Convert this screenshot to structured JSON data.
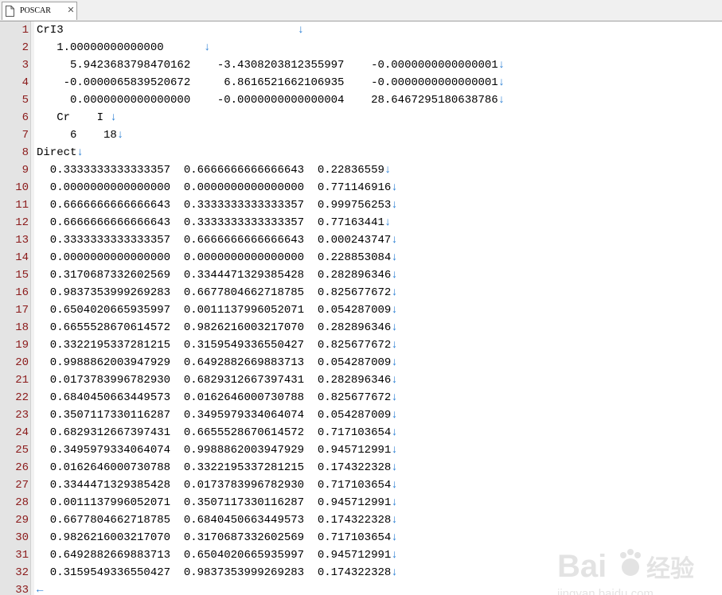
{
  "tab": {
    "title": "POSCAR",
    "close_glyph": "✕",
    "icon": "document-icon"
  },
  "eol_colors": {
    "line_numbers": "#8b1a1a",
    "eol_marker": "#2a7fd4"
  },
  "lines": [
    {
      "n": "1",
      "text": "CrI3                                   ",
      "eol": "↓"
    },
    {
      "n": "2",
      "text": "   1.00000000000000      ",
      "eol": "↓"
    },
    {
      "n": "3",
      "text": "     5.9423683798470162    -3.4308203812355997    -0.0000000000000001",
      "eol": "↓"
    },
    {
      "n": "4",
      "text": "    -0.0000065839520672     6.8616521662106935    -0.0000000000000001",
      "eol": "↓"
    },
    {
      "n": "5",
      "text": "     0.0000000000000000    -0.0000000000000004    28.6467295180638786",
      "eol": "↓"
    },
    {
      "n": "6",
      "text": "   Cr    I ",
      "eol": "↓"
    },
    {
      "n": "7",
      "text": "     6    18",
      "eol": "↓"
    },
    {
      "n": "8",
      "text": "Direct",
      "eol": "↓"
    },
    {
      "n": "9",
      "text": "  0.3333333333333357  0.6666666666666643  0.22836559",
      "eol": "↓"
    },
    {
      "n": "10",
      "text": "  0.0000000000000000  0.0000000000000000  0.771146916",
      "eol": "↓"
    },
    {
      "n": "11",
      "text": "  0.6666666666666643  0.3333333333333357  0.999756253",
      "eol": "↓"
    },
    {
      "n": "12",
      "text": "  0.6666666666666643  0.3333333333333357  0.77163441",
      "eol": "↓"
    },
    {
      "n": "13",
      "text": "  0.3333333333333357  0.6666666666666643  0.000243747",
      "eol": "↓"
    },
    {
      "n": "14",
      "text": "  0.0000000000000000  0.0000000000000000  0.228853084",
      "eol": "↓"
    },
    {
      "n": "15",
      "text": "  0.3170687332602569  0.3344471329385428  0.282896346",
      "eol": "↓"
    },
    {
      "n": "16",
      "text": "  0.9837353999269283  0.6677804662718785  0.825677672",
      "eol": "↓"
    },
    {
      "n": "17",
      "text": "  0.6504020665935997  0.0011137996052071  0.054287009",
      "eol": "↓"
    },
    {
      "n": "18",
      "text": "  0.6655528670614572  0.9826216003217070  0.282896346",
      "eol": "↓"
    },
    {
      "n": "19",
      "text": "  0.3322195337281215  0.3159549336550427  0.825677672",
      "eol": "↓"
    },
    {
      "n": "20",
      "text": "  0.9988862003947929  0.6492882669883713  0.054287009",
      "eol": "↓"
    },
    {
      "n": "21",
      "text": "  0.0173783996782930  0.6829312667397431  0.282896346",
      "eol": "↓"
    },
    {
      "n": "22",
      "text": "  0.6840450663449573  0.0162646000730788  0.825677672",
      "eol": "↓"
    },
    {
      "n": "23",
      "text": "  0.3507117330116287  0.3495979334064074  0.054287009",
      "eol": "↓"
    },
    {
      "n": "24",
      "text": "  0.6829312667397431  0.6655528670614572  0.717103654",
      "eol": "↓"
    },
    {
      "n": "25",
      "text": "  0.3495979334064074  0.9988862003947929  0.945712991",
      "eol": "↓"
    },
    {
      "n": "26",
      "text": "  0.0162646000730788  0.3322195337281215  0.174322328",
      "eol": "↓"
    },
    {
      "n": "27",
      "text": "  0.3344471329385428  0.0173783996782930  0.717103654",
      "eol": "↓"
    },
    {
      "n": "28",
      "text": "  0.0011137996052071  0.3507117330116287  0.945712991",
      "eol": "↓"
    },
    {
      "n": "29",
      "text": "  0.6677804662718785  0.6840450663449573  0.174322328",
      "eol": "↓"
    },
    {
      "n": "30",
      "text": "  0.9826216003217070  0.3170687332602569  0.717103654",
      "eol": "↓"
    },
    {
      "n": "31",
      "text": "  0.6492882669883713  0.6504020665935997  0.945712991",
      "eol": "↓"
    },
    {
      "n": "32",
      "text": "  0.3159549336550427  0.9837353999269283  0.174322328",
      "eol": "↓"
    },
    {
      "n": "33",
      "text": "",
      "eol": "←"
    }
  ],
  "watermark": {
    "text_main": "Bai",
    "text_du": "du",
    "text_cn": "经验",
    "url": "jingyan.baidu.com"
  }
}
